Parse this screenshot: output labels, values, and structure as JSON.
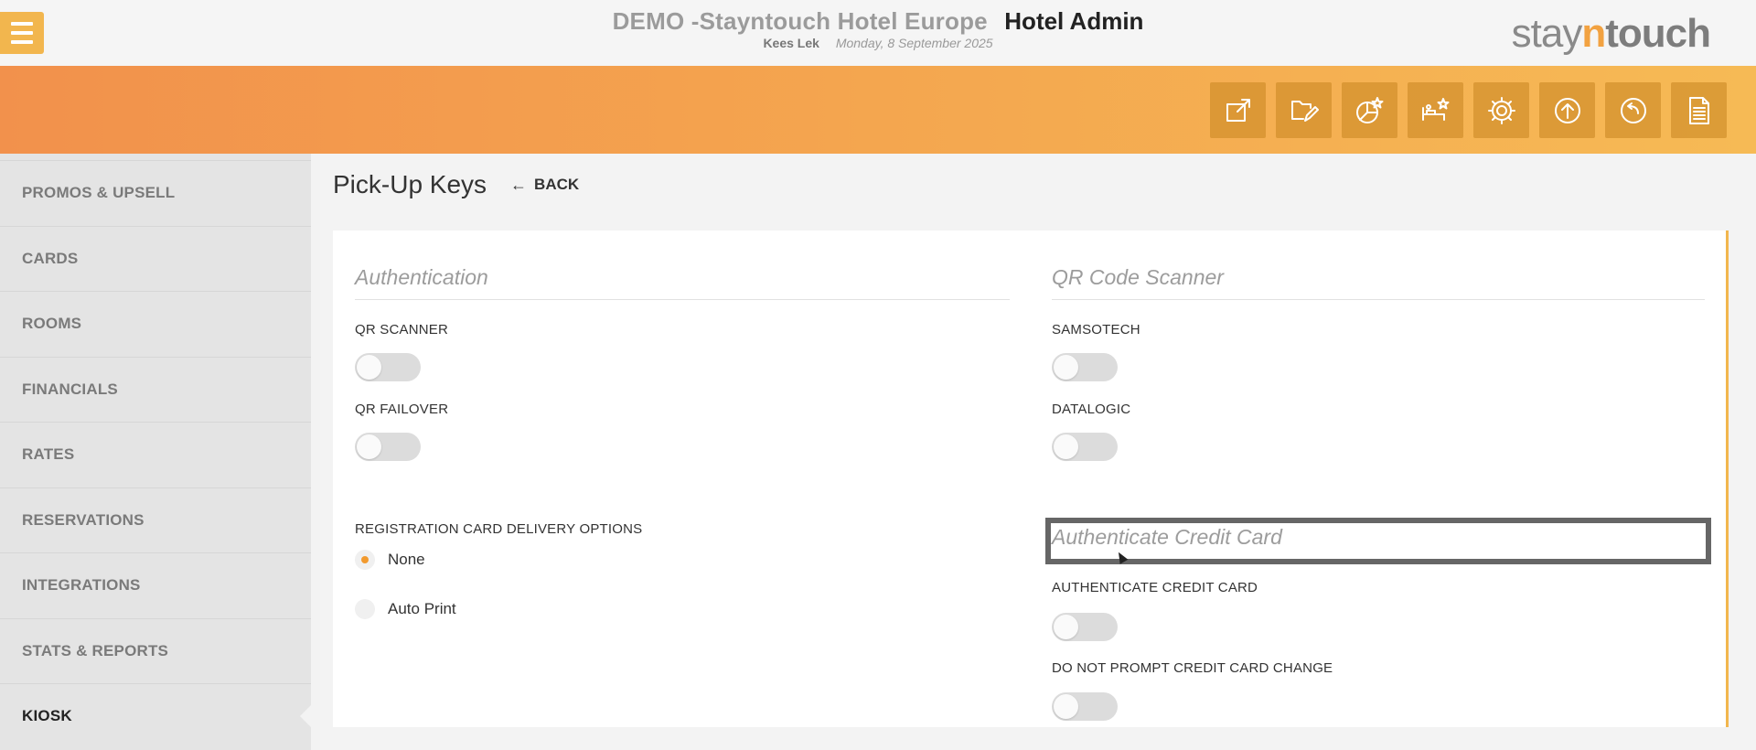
{
  "header": {
    "hotel_name": "DEMO -Stayntouch Hotel Europe",
    "app_name": "Hotel Admin",
    "user": "Kees Lek",
    "date": "Monday, 8 September 2025",
    "brand_part1": "stay",
    "brand_part2": "n",
    "brand_part3": "touch"
  },
  "toolbar": {
    "icons": [
      "external-link-icon",
      "folder-edit-icon",
      "chart-star-icon",
      "bed-star-icon",
      "gear-icon",
      "upload-circle-icon",
      "logout-circle-icon",
      "document-icon"
    ]
  },
  "sidebar": {
    "items": [
      {
        "label": "PROMOS & UPSELL"
      },
      {
        "label": "CARDS"
      },
      {
        "label": "ROOMS"
      },
      {
        "label": "FINANCIALS"
      },
      {
        "label": "RATES"
      },
      {
        "label": "RESERVATIONS"
      },
      {
        "label": "INTEGRATIONS"
      },
      {
        "label": "STATS & REPORTS"
      },
      {
        "label": "KIOSK"
      }
    ],
    "active": "KIOSK"
  },
  "page": {
    "title": "Pick-Up Keys",
    "back_label": "BACK"
  },
  "left": {
    "section_title": "Authentication",
    "qr_scanner_label": "QR SCANNER",
    "qr_failover_label": "QR FAILOVER",
    "reg_card_label": "REGISTRATION CARD DELIVERY OPTIONS",
    "options": [
      "None",
      "Auto Print"
    ],
    "selected_option": "None"
  },
  "right": {
    "qr_section_title": "QR Code Scanner",
    "samsotech_label": "SAMSOTECH",
    "datalogic_label": "DATALOGIC",
    "auth_section_title": "Authenticate Credit Card",
    "auth_cc_label": "AUTHENTICATE CREDIT CARD",
    "no_prompt_label": "DO NOT PROMPT CREDIT CARD CHANGE"
  },
  "toggles": {
    "qr_scanner": false,
    "qr_failover": false,
    "samsotech": false,
    "datalogic": false,
    "authenticate_credit_card": false,
    "do_not_prompt_cc_change": false
  },
  "colors": {
    "accent": "#f2b64e",
    "band_start": "#f2914c",
    "band_end": "#f6ba55",
    "radio_selected": "#f29a2e"
  }
}
